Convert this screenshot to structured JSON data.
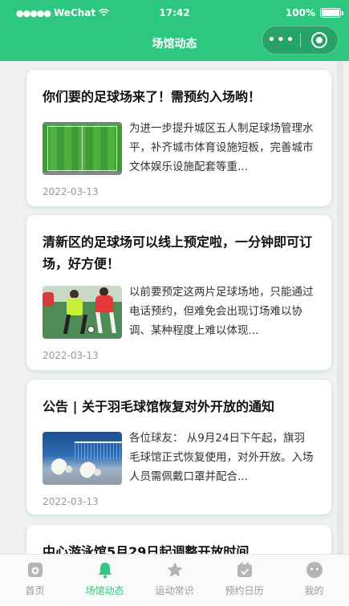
{
  "status_bar": {
    "carrier": "WeChat",
    "signal_dots": "●●●●●",
    "time": "17:42",
    "battery": "100%"
  },
  "nav": {
    "title": "场馆动态",
    "more_glyph": "•••"
  },
  "articles": [
    {
      "title": "你们要的足球场来了！需预约入场哟！",
      "summary": "为进一步提升城区五人制足球场管理水平，补齐城市体育设施短板，完善城市文体娱乐设施配套等重...",
      "date": "2022-03-13",
      "image": "football-pitch-aerial"
    },
    {
      "title": "清新区的足球场可以线上预定啦，一分钟即可订场，好方便！",
      "summary": "以前要预定这两片足球场地，只能通过电话预约，但难免会出现订场难以协调、某种程度上难以体现...",
      "date": "2022-03-13",
      "image": "football-players"
    },
    {
      "title": "公告 | 关于羽毛球馆恢复对外开放的通知",
      "summary": "各位球友： 从9月24日下午起，旗羽毛球馆正式恢复使用，对外开放。入场人员需佩戴口罩并配合...",
      "date": "2022-03-13",
      "image": "badminton-shuttlecocks"
    },
    {
      "title": "中心游泳馆5月29日起调整开放时间"
    }
  ],
  "tabs": [
    {
      "label": "首页",
      "icon": "home-icon",
      "active": false
    },
    {
      "label": "场馆动态",
      "icon": "bell-icon",
      "active": true
    },
    {
      "label": "运动常识",
      "icon": "star-icon",
      "active": false
    },
    {
      "label": "预约日历",
      "icon": "calendar-icon",
      "active": false
    },
    {
      "label": "我的",
      "icon": "user-face-icon",
      "active": false
    }
  ],
  "colors": {
    "brand": "#2ec77f",
    "tab_inactive": "#999999"
  }
}
